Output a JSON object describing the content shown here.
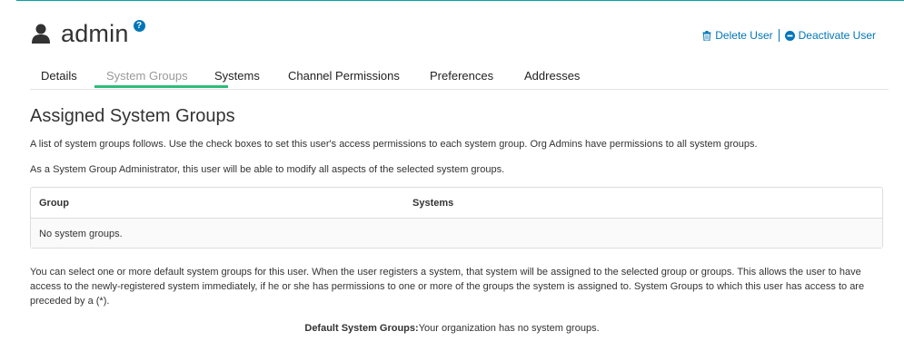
{
  "header": {
    "username": "admin",
    "user_icon": "user-icon",
    "help_icon": "question-circle-icon",
    "help_glyph": "?",
    "actions": {
      "delete_label": "Delete User",
      "delete_icon": "trash-icon",
      "deactivate_label": "Deactivate User",
      "deactivate_icon": "minus-circle-icon"
    }
  },
  "tabs": [
    {
      "label": "Details",
      "active": false
    },
    {
      "label": "System Groups",
      "active": true
    },
    {
      "label": "Systems",
      "active": false
    },
    {
      "label": "Channel Permissions",
      "active": false
    },
    {
      "label": "Preferences",
      "active": false
    },
    {
      "label": "Addresses",
      "active": false
    }
  ],
  "section": {
    "title": "Assigned System Groups",
    "description1": "A list of system groups follows. Use the check boxes to set this user's access permissions to each system group. Org Admins have permissions to all system groups.",
    "description2": "As a System Group Administrator, this user will be able to modify all aspects of the selected system groups."
  },
  "table": {
    "columns": [
      "Group",
      "Systems"
    ],
    "empty_message": "No system groups."
  },
  "default_info": "You can select one or more default system groups for this user. When the user registers a system, that system will be assigned to the selected group or groups. This allows the user to have access to the newly-registered system immediately, if he or she has permissions to one or more of the groups the system is assigned to. System Groups to which this user has access to are preceded by a (*).",
  "default_groups": {
    "label": "Default System Groups:",
    "value": "Your organization has no system groups."
  },
  "colors": {
    "accent": "#0076b8",
    "active_tab_underline": "#2ebd7a",
    "top_rule": "#00a6a6"
  }
}
